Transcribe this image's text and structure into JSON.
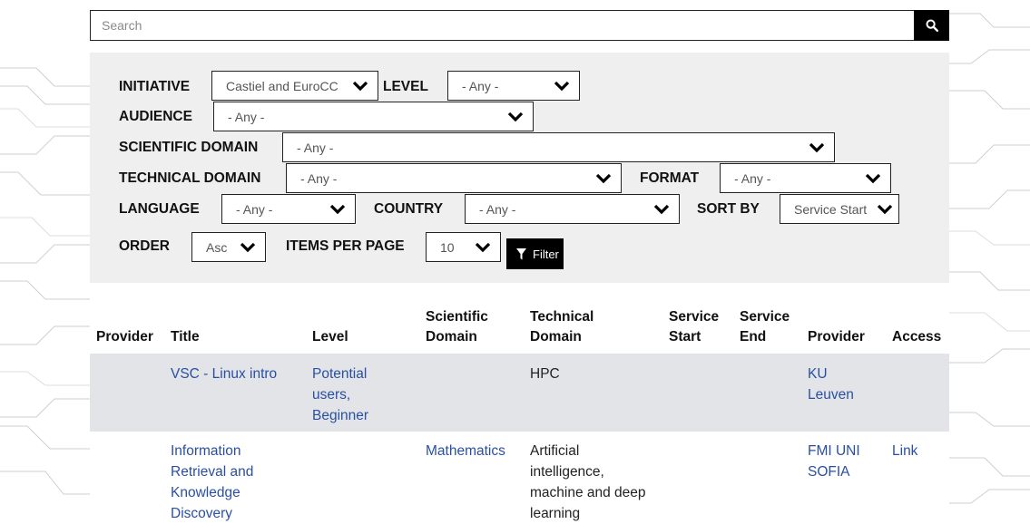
{
  "search": {
    "placeholder": "Search"
  },
  "filters": {
    "initiative": {
      "label": "INITIATIVE",
      "value": "Castiel and EuroCC"
    },
    "level": {
      "label": "LEVEL",
      "value": "- Any -"
    },
    "audience": {
      "label": "AUDIENCE",
      "value": "- Any -"
    },
    "scientific_domain": {
      "label": "SCIENTIFIC DOMAIN",
      "value": "- Any -"
    },
    "technical_domain": {
      "label": "TECHNICAL DOMAIN",
      "value": "- Any -"
    },
    "format": {
      "label": "FORMAT",
      "value": "- Any -"
    },
    "language": {
      "label": "LANGUAGE",
      "value": "- Any -"
    },
    "country": {
      "label": "COUNTRY",
      "value": "- Any -"
    },
    "sort_by": {
      "label": "SORT BY",
      "value": "Service Start"
    },
    "order": {
      "label": "ORDER",
      "value": "Asc"
    },
    "items_per_page": {
      "label": "ITEMS PER PAGE",
      "value": "10"
    },
    "filter_button": "Filter"
  },
  "table": {
    "headers": {
      "provider_logo": "Provider",
      "title": "Title",
      "level": "Level",
      "scientific_domain_1": "Scientific",
      "scientific_domain_2": "Domain",
      "technical_domain_1": "Technical",
      "technical_domain_2": "Domain",
      "service_start_1": "Service",
      "service_start_2": "Start",
      "service_end_1": "Service",
      "service_end_2": "End",
      "provider": "Provider",
      "access": "Access"
    },
    "rows": [
      {
        "title": [
          "VSC - Linux intro"
        ],
        "level": [
          "Potential",
          "users,",
          "Beginner"
        ],
        "scientific_domain": [],
        "technical_domain": [
          "HPC"
        ],
        "provider": [
          "KU",
          "Leuven"
        ],
        "access": ""
      },
      {
        "title": [
          "Information",
          "Retrieval and",
          "Knowledge",
          "Discovery"
        ],
        "level": [],
        "scientific_domain": [
          "Mathematics"
        ],
        "technical_domain": [
          "Artificial",
          "intelligence,",
          "machine and deep",
          "learning"
        ],
        "provider": [
          "FMI UNI",
          "SOFIA"
        ],
        "access": "Link"
      }
    ]
  },
  "icons": {
    "search": "search-icon",
    "chevron": "chevron-down-icon",
    "filter": "filter-icon"
  },
  "colors": {
    "link": "#2a4fa2",
    "panel_bg": "#efefef",
    "row_highlight": "#e2e4e8",
    "button_bg": "#000000"
  }
}
